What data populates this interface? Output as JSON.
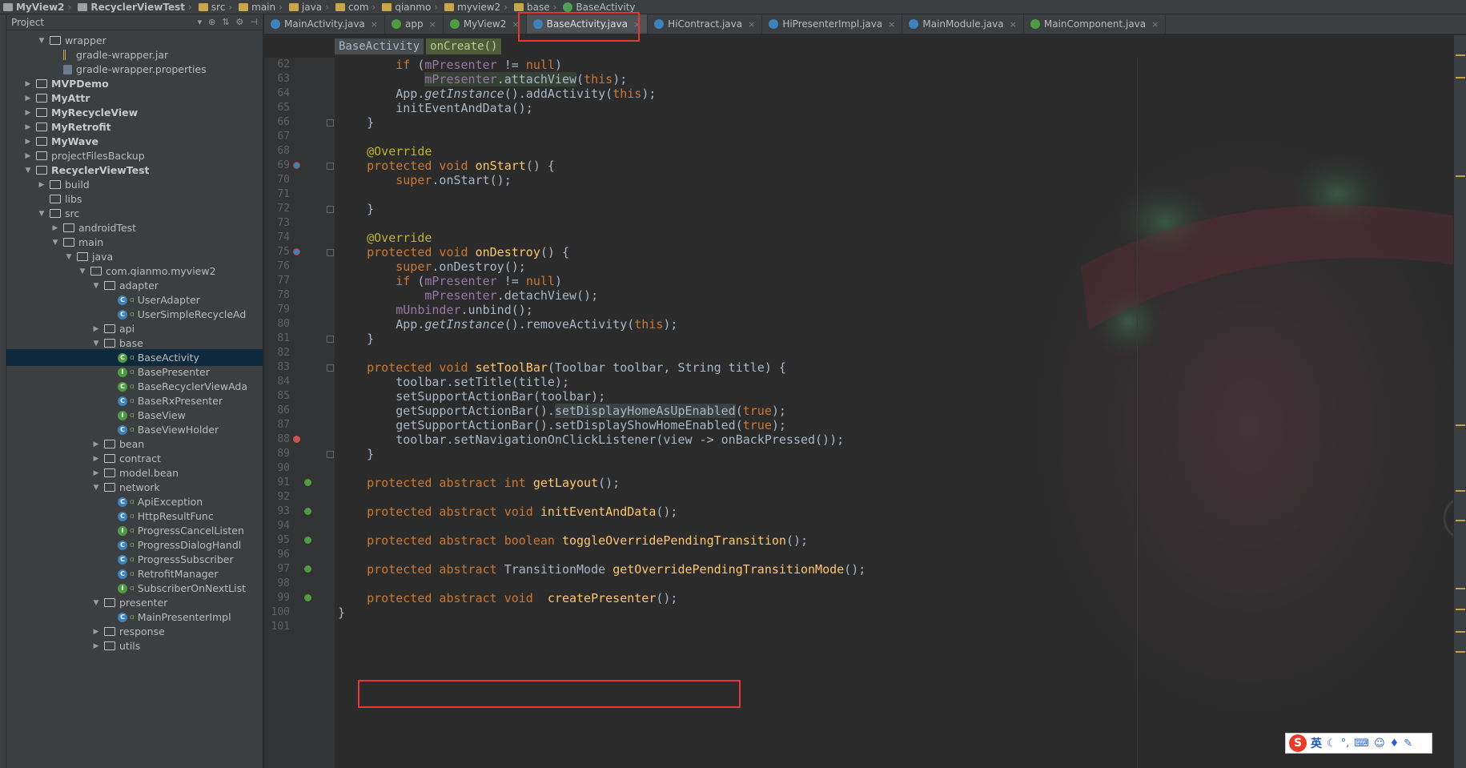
{
  "navbar": {
    "crumbs": [
      "MyView2",
      "RecyclerViewTest",
      "src",
      "main",
      "java",
      "com",
      "qianmo",
      "myview2",
      "base",
      "BaseActivity"
    ]
  },
  "project_panel": {
    "title": "Project",
    "tree": [
      {
        "label": "wrapper",
        "kind": "folder",
        "depth": 2,
        "arrow": "down"
      },
      {
        "label": "gradle-wrapper.jar",
        "kind": "jar",
        "depth": 3,
        "arrow": ""
      },
      {
        "label": "gradle-wrapper.properties",
        "kind": "props",
        "depth": 3,
        "arrow": ""
      },
      {
        "label": "MVPDemo",
        "kind": "module",
        "depth": 1,
        "arrow": "right",
        "bold": true
      },
      {
        "label": "MyAttr",
        "kind": "module",
        "depth": 1,
        "arrow": "right",
        "bold": true
      },
      {
        "label": "MyRecycleView",
        "kind": "module",
        "depth": 1,
        "arrow": "right",
        "bold": true
      },
      {
        "label": "MyRetrofit",
        "kind": "module",
        "depth": 1,
        "arrow": "right",
        "bold": true
      },
      {
        "label": "MyWave",
        "kind": "module",
        "depth": 1,
        "arrow": "right",
        "bold": true
      },
      {
        "label": "projectFilesBackup",
        "kind": "folder",
        "depth": 1,
        "arrow": "right"
      },
      {
        "label": "RecyclerViewTest",
        "kind": "module",
        "depth": 1,
        "arrow": "down",
        "bold": true
      },
      {
        "label": "build",
        "kind": "folder",
        "depth": 2,
        "arrow": "right"
      },
      {
        "label": "libs",
        "kind": "folder",
        "depth": 2,
        "arrow": ""
      },
      {
        "label": "src",
        "kind": "folder",
        "depth": 2,
        "arrow": "down"
      },
      {
        "label": "androidTest",
        "kind": "folder",
        "depth": 3,
        "arrow": "right"
      },
      {
        "label": "main",
        "kind": "folder",
        "depth": 3,
        "arrow": "down"
      },
      {
        "label": "java",
        "kind": "folder",
        "depth": 4,
        "arrow": "down"
      },
      {
        "label": "com.qianmo.myview2",
        "kind": "folder",
        "depth": 5,
        "arrow": "down"
      },
      {
        "label": "adapter",
        "kind": "folder",
        "depth": 6,
        "arrow": "down"
      },
      {
        "label": "UserAdapter",
        "kind": "class",
        "depth": 7,
        "arrow": ""
      },
      {
        "label": "UserSimpleRecycleAd",
        "kind": "class",
        "depth": 7,
        "arrow": ""
      },
      {
        "label": "api",
        "kind": "folder",
        "depth": 6,
        "arrow": "right"
      },
      {
        "label": "base",
        "kind": "folder",
        "depth": 6,
        "arrow": "down"
      },
      {
        "label": "BaseActivity",
        "kind": "abstract",
        "depth": 7,
        "arrow": "",
        "selected": true
      },
      {
        "label": "BasePresenter",
        "kind": "interface",
        "depth": 7,
        "arrow": ""
      },
      {
        "label": "BaseRecyclerViewAda",
        "kind": "abstract",
        "depth": 7,
        "arrow": ""
      },
      {
        "label": "BaseRxPresenter",
        "kind": "class",
        "depth": 7,
        "arrow": ""
      },
      {
        "label": "BaseView",
        "kind": "interface",
        "depth": 7,
        "arrow": ""
      },
      {
        "label": "BaseViewHolder",
        "kind": "class",
        "depth": 7,
        "arrow": ""
      },
      {
        "label": "bean",
        "kind": "folder",
        "depth": 6,
        "arrow": "right"
      },
      {
        "label": "contract",
        "kind": "folder",
        "depth": 6,
        "arrow": "right"
      },
      {
        "label": "model.bean",
        "kind": "folder",
        "depth": 6,
        "arrow": "right"
      },
      {
        "label": "network",
        "kind": "folder",
        "depth": 6,
        "arrow": "down"
      },
      {
        "label": "ApiException",
        "kind": "class",
        "depth": 7,
        "arrow": ""
      },
      {
        "label": "HttpResultFunc",
        "kind": "class",
        "depth": 7,
        "arrow": ""
      },
      {
        "label": "ProgressCancelListen",
        "kind": "interface",
        "depth": 7,
        "arrow": ""
      },
      {
        "label": "ProgressDialogHandl",
        "kind": "class",
        "depth": 7,
        "arrow": ""
      },
      {
        "label": "ProgressSubscriber",
        "kind": "class",
        "depth": 7,
        "arrow": ""
      },
      {
        "label": "RetrofitManager",
        "kind": "class",
        "depth": 7,
        "arrow": ""
      },
      {
        "label": "SubscriberOnNextList",
        "kind": "interface",
        "depth": 7,
        "arrow": ""
      },
      {
        "label": "presenter",
        "kind": "folder",
        "depth": 6,
        "arrow": "down"
      },
      {
        "label": "MainPresenterImpl",
        "kind": "class",
        "depth": 7,
        "arrow": ""
      },
      {
        "label": "response",
        "kind": "folder",
        "depth": 6,
        "arrow": "right"
      },
      {
        "label": "utils",
        "kind": "folder",
        "depth": 6,
        "arrow": "right"
      }
    ]
  },
  "tabs": [
    {
      "label": "MainActivity.java",
      "icon": "c",
      "active": false
    },
    {
      "label": "app",
      "icon": "g",
      "active": false
    },
    {
      "label": "MyView2",
      "icon": "g",
      "active": false
    },
    {
      "label": "BaseActivity.java",
      "icon": "c",
      "active": true
    },
    {
      "label": "HiContract.java",
      "icon": "c",
      "active": false
    },
    {
      "label": "HiPresenterImpl.java",
      "icon": "c",
      "active": false
    },
    {
      "label": "MainModule.java",
      "icon": "c",
      "active": false
    },
    {
      "label": "MainComponent.java",
      "icon": "g",
      "active": false
    }
  ],
  "editor_breadcrumb": {
    "class": "BaseActivity",
    "method": "onCreate()"
  },
  "code_lines": [
    {
      "n": "62",
      "parts": [
        [
          "",
          "        "
        ],
        [
          "kw",
          "if"
        ],
        [
          "",
          " ("
        ],
        [
          "fld",
          "mPresenter"
        ],
        [
          "",
          " != "
        ],
        [
          "kw",
          "null"
        ],
        [
          "",
          ")"
        ]
      ]
    },
    {
      "n": "63",
      "parts": [
        [
          "",
          "            "
        ],
        [
          "fld hl",
          "mPresenter"
        ],
        [
          "hl",
          ".attachView"
        ],
        [
          "",
          "("
        ],
        [
          "kw",
          "this"
        ],
        [
          "",
          ");"
        ]
      ]
    },
    {
      "n": "64",
      "parts": [
        [
          "",
          "        App."
        ],
        [
          "it",
          "getInstance"
        ],
        [
          "",
          "().addActivity("
        ],
        [
          "kw",
          "this"
        ],
        [
          "",
          ");"
        ]
      ]
    },
    {
      "n": "65",
      "parts": [
        [
          "",
          "        initEventAndData();"
        ]
      ]
    },
    {
      "n": "66",
      "parts": [
        [
          "",
          "    }"
        ]
      ]
    },
    {
      "n": "67",
      "parts": [
        [
          "",
          ""
        ]
      ]
    },
    {
      "n": "68",
      "parts": [
        [
          "",
          "    "
        ],
        [
          "ann",
          "@Override"
        ]
      ]
    },
    {
      "n": "69",
      "parts": [
        [
          "",
          "    "
        ],
        [
          "kw",
          "protected void "
        ],
        [
          "fn",
          "onStart"
        ],
        [
          "",
          "() {"
        ]
      ]
    },
    {
      "n": "70",
      "parts": [
        [
          "",
          "        "
        ],
        [
          "kw",
          "super"
        ],
        [
          "",
          ".onStart();"
        ]
      ]
    },
    {
      "n": "71",
      "parts": [
        [
          "",
          ""
        ]
      ]
    },
    {
      "n": "72",
      "parts": [
        [
          "",
          "    }"
        ]
      ]
    },
    {
      "n": "73",
      "parts": [
        [
          "",
          ""
        ]
      ]
    },
    {
      "n": "74",
      "parts": [
        [
          "",
          "    "
        ],
        [
          "ann",
          "@Override"
        ]
      ]
    },
    {
      "n": "75",
      "parts": [
        [
          "",
          "    "
        ],
        [
          "kw",
          "protected void "
        ],
        [
          "fn",
          "onDestroy"
        ],
        [
          "",
          "() {"
        ]
      ]
    },
    {
      "n": "76",
      "parts": [
        [
          "",
          "        "
        ],
        [
          "kw",
          "super"
        ],
        [
          "",
          ".onDestroy();"
        ]
      ]
    },
    {
      "n": "77",
      "parts": [
        [
          "",
          "        "
        ],
        [
          "kw",
          "if"
        ],
        [
          "",
          " ("
        ],
        [
          "fld",
          "mPresenter"
        ],
        [
          "",
          " != "
        ],
        [
          "kw",
          "null"
        ],
        [
          "",
          ")"
        ]
      ]
    },
    {
      "n": "78",
      "parts": [
        [
          "",
          "            "
        ],
        [
          "fld",
          "mPresenter"
        ],
        [
          "",
          ".detachView();"
        ]
      ]
    },
    {
      "n": "79",
      "parts": [
        [
          "",
          "        "
        ],
        [
          "fld",
          "mUnbinder"
        ],
        [
          "",
          ".unbind();"
        ]
      ]
    },
    {
      "n": "80",
      "parts": [
        [
          "",
          "        App."
        ],
        [
          "it",
          "getInstance"
        ],
        [
          "",
          "().removeActivity("
        ],
        [
          "kw",
          "this"
        ],
        [
          "",
          ");"
        ]
      ]
    },
    {
      "n": "81",
      "parts": [
        [
          "",
          "    }"
        ]
      ]
    },
    {
      "n": "82",
      "parts": [
        [
          "",
          ""
        ]
      ]
    },
    {
      "n": "83",
      "parts": [
        [
          "",
          "    "
        ],
        [
          "kw",
          "protected void "
        ],
        [
          "fn",
          "setToolBar"
        ],
        [
          "",
          "(Toolbar toolbar, String title) {"
        ]
      ]
    },
    {
      "n": "84",
      "parts": [
        [
          "",
          "        toolbar.setTitle(title);"
        ]
      ]
    },
    {
      "n": "85",
      "parts": [
        [
          "",
          "        setSupportActionBar(toolbar);"
        ]
      ]
    },
    {
      "n": "86",
      "parts": [
        [
          "",
          "        getSupportActionBar()."
        ],
        [
          "hl2",
          "setDisplayHomeAsUpEnabled"
        ],
        [
          "",
          "("
        ],
        [
          "kw",
          "true"
        ],
        [
          "",
          ");"
        ]
      ]
    },
    {
      "n": "87",
      "parts": [
        [
          "",
          "        getSupportActionBar().setDisplayShowHomeEnabled("
        ],
        [
          "kw",
          "true"
        ],
        [
          "",
          ");"
        ]
      ]
    },
    {
      "n": "88",
      "parts": [
        [
          "",
          "        toolbar.setNavigationOnClickListener(view -> onBackPressed());"
        ]
      ]
    },
    {
      "n": "89",
      "parts": [
        [
          "",
          "    }"
        ]
      ]
    },
    {
      "n": "90",
      "parts": [
        [
          "",
          ""
        ]
      ]
    },
    {
      "n": "91",
      "parts": [
        [
          "",
          "    "
        ],
        [
          "kw",
          "protected abstract int "
        ],
        [
          "fn",
          "getLayout"
        ],
        [
          "",
          "();"
        ]
      ]
    },
    {
      "n": "92",
      "parts": [
        [
          "",
          ""
        ]
      ]
    },
    {
      "n": "93",
      "parts": [
        [
          "",
          "    "
        ],
        [
          "kw",
          "protected abstract void "
        ],
        [
          "fn",
          "initEventAndData"
        ],
        [
          "",
          "();"
        ]
      ]
    },
    {
      "n": "94",
      "parts": [
        [
          "",
          ""
        ]
      ]
    },
    {
      "n": "95",
      "parts": [
        [
          "",
          "    "
        ],
        [
          "kw",
          "protected abstract boolean "
        ],
        [
          "fn",
          "toggleOverridePendingTransition"
        ],
        [
          "",
          "();"
        ]
      ]
    },
    {
      "n": "96",
      "parts": [
        [
          "",
          ""
        ]
      ]
    },
    {
      "n": "97",
      "parts": [
        [
          "",
          "    "
        ],
        [
          "kw",
          "protected abstract "
        ],
        [
          "",
          "TransitionMode "
        ],
        [
          "fn",
          "getOverridePendingTransitionMode"
        ],
        [
          "",
          "();"
        ]
      ]
    },
    {
      "n": "98",
      "parts": [
        [
          "",
          ""
        ]
      ]
    },
    {
      "n": "99",
      "parts": [
        [
          "",
          "    "
        ],
        [
          "kw",
          "protected abstract void  "
        ],
        [
          "fn",
          "createPresenter"
        ],
        [
          "",
          "();"
        ]
      ]
    },
    {
      "n": "100",
      "parts": [
        [
          "",
          "}"
        ]
      ]
    },
    {
      "n": "101",
      "parts": [
        [
          "",
          ""
        ]
      ]
    }
  ],
  "gutter_icons": {
    "69": "override-icon",
    "75": "override-icon",
    "88": "breakpoint-icon",
    "91": "implemented-icon",
    "93": "implemented-icon",
    "95": "implemented-icon",
    "97": "implemented-icon",
    "99": "implemented-icon"
  },
  "ime": {
    "logo": "S",
    "mode": "英"
  },
  "colors": {
    "keyword": "#cc7832",
    "field": "#9876aa",
    "annotation": "#bbb529",
    "method": "#ffc66d",
    "highlight_box": "#e53935"
  }
}
